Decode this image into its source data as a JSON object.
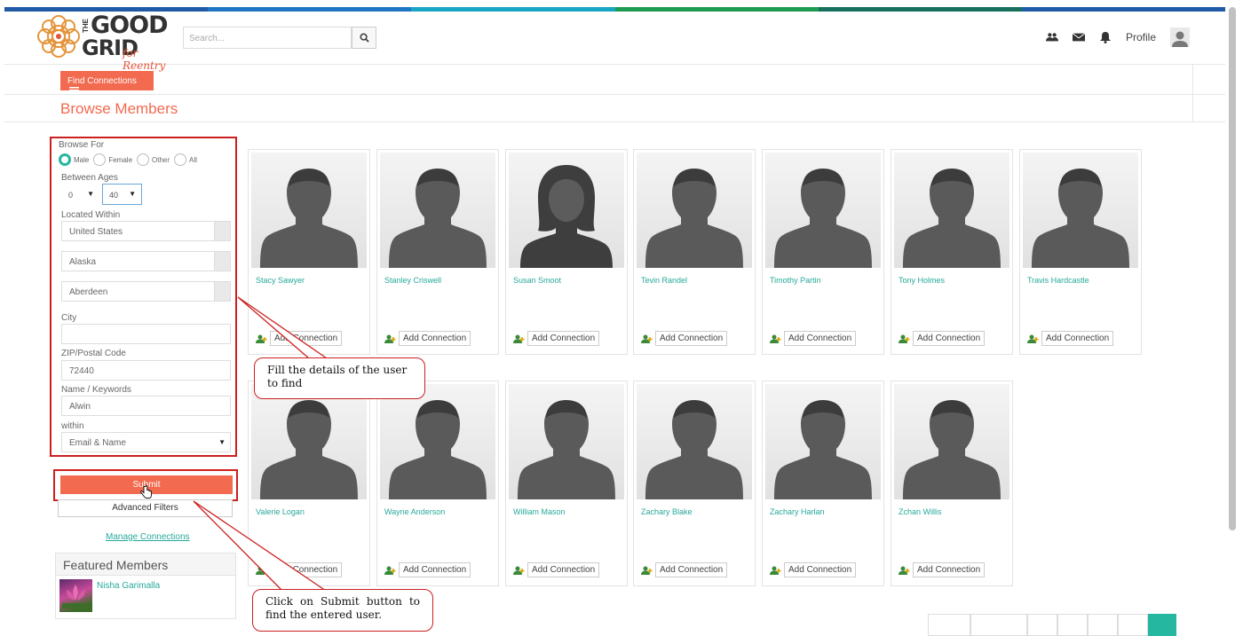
{
  "brand": {
    "the": "THE",
    "good": "GOOD",
    "grid": "GRID",
    "tagline": "for Reentry",
    "colors": [
      "#1f5aa6",
      "#1f77c4",
      "#18a6c4",
      "#1e9a52",
      "#17705e",
      "#1f5aa6"
    ]
  },
  "header": {
    "search_placeholder": "Search...",
    "profile_label": "Profile"
  },
  "toolbar": {
    "find_connections": "Find Connections"
  },
  "page": {
    "title": "Browse Members"
  },
  "filter": {
    "browse_for_label": "Browse For",
    "genders": [
      "Male",
      "Female",
      "Other",
      "All"
    ],
    "selected_gender": "Male",
    "between_ages_label": "Between Ages",
    "age_min": "0",
    "age_max": "40",
    "located_within_label": "Located Within",
    "country": "United States",
    "state": "Alaska",
    "city_select": "Aberdeen",
    "city_label": "City",
    "city_value": "",
    "zip_label": "ZIP/Postal Code",
    "zip_value": "72440",
    "keywords_label": "Name / Keywords",
    "keywords_value": "Alwin",
    "within_label": "within",
    "within_value": "Email & Name"
  },
  "actions": {
    "submit": "Submit",
    "advanced_filters": "Advanced Filters",
    "manage_connections": "Manage Connections"
  },
  "featured": {
    "title": "Featured Members",
    "members": [
      "Nisha Garimalla"
    ]
  },
  "members": [
    {
      "name": "Stacy Sawyer",
      "gender": "male"
    },
    {
      "name": "Stanley Criswell",
      "gender": "male"
    },
    {
      "name": "Susan Smoot",
      "gender": "female"
    },
    {
      "name": "Tevin Randel",
      "gender": "male"
    },
    {
      "name": "Timothy Partin",
      "gender": "male"
    },
    {
      "name": "Tony Holmes",
      "gender": "male"
    },
    {
      "name": "Travis Hardcastle",
      "gender": "male"
    },
    {
      "name": "Valerie Logan",
      "gender": "male"
    },
    {
      "name": "Wayne Anderson",
      "gender": "male"
    },
    {
      "name": "William Mason",
      "gender": "male"
    },
    {
      "name": "Zachary Blake",
      "gender": "male"
    },
    {
      "name": "Zachary Harlan",
      "gender": "male"
    },
    {
      "name": "Zchan Willis",
      "gender": "male"
    }
  ],
  "add_connection_label": "Add Connection",
  "callouts": {
    "fill": "Fill the details of the user to find",
    "submit": "Click on Submit button to find the entered user."
  }
}
